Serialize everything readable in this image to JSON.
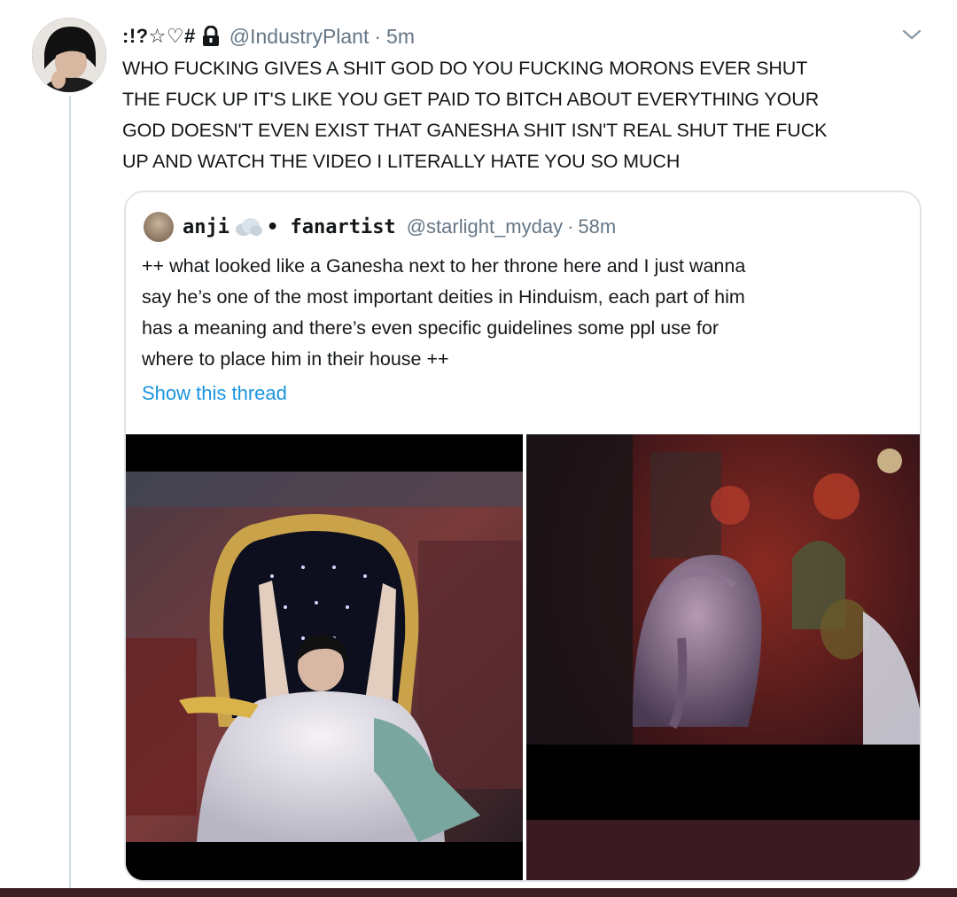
{
  "tweet": {
    "display_name": ":!?☆♡#",
    "handle": "@IndustryPlant",
    "separator": "·",
    "time": "5m",
    "text_lines": [
      "WHO FUCKING GIVES A SHIT GOD DO YOU FUCKING MORONS EVER SHUT",
      "THE FUCK UP IT'S LIKE YOU GET PAID TO BITCH ABOUT EVERYTHING YOUR",
      "GOD DOESN'T EVEN EXIST THAT GANESHA SHIT ISN'T REAL SHUT THE FUCK",
      "UP AND WATCH THE VIDEO I LITERALLY HATE YOU SO MUCH"
    ],
    "icons": {
      "protected": "lock-icon",
      "more": "chevron-down-icon"
    }
  },
  "quote": {
    "name_part1": "anji",
    "name_part2": "• fanartist",
    "handle": "@starlight_myday",
    "separator": "·",
    "time": "58m",
    "text_lines": [
      "++ what looked like a Ganesha next to her throne here and I just wanna",
      "say he’s one of the most important deities in Hinduism, each part of him",
      "has a meaning and there’s even specific guidelines some ppl use for",
      "where to place him in their house ++"
    ],
    "show_thread": "Show this thread",
    "icons": {
      "name_emoji": "cloud-icon"
    }
  },
  "colors": {
    "text": "#14171a",
    "muted": "#657786",
    "link": "#1b95e0",
    "border": "#dfe5ea",
    "bottom_bar": "#3b1f24"
  }
}
